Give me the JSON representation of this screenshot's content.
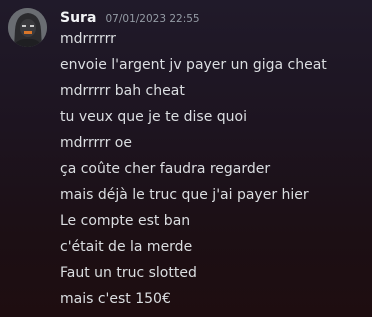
{
  "author": {
    "username": "Sura",
    "timestamp": "07/01/2023 22:55",
    "avatar_icon": "masked-figure-avatar"
  },
  "messages": [
    "mdrrrrrr",
    "envoie l'argent jv payer un giga cheat",
    "mdrrrrr bah cheat",
    "tu veux que je te dise quoi",
    "mdrrrrr oe",
    "ça coûte cher faudra regarder",
    "mais déjà le truc que j'ai payer hier",
    "Le compte est ban",
    "c'était de la merde",
    "Faut un truc slotted",
    "mais c'est 150€"
  ],
  "colors": {
    "background_top": "#201a2a",
    "background_bottom": "#1e0d10",
    "username": "#f2f3f5",
    "timestamp": "#949ba4",
    "message_text": "#dbdee1"
  }
}
